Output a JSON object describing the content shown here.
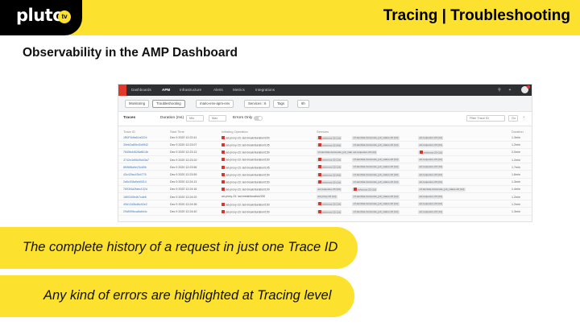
{
  "header": {
    "logo_text": "pluto",
    "logo_badge": "tv",
    "title": "Tracing | Troubleshooting",
    "accent_color": "#fde12f"
  },
  "subtitle": "Observability in the AMP Dashboard",
  "dashboard": {
    "nav": [
      "Dashboards",
      "APM",
      "Infrastructure",
      "Alerts",
      "Metrics",
      "Integrations"
    ],
    "active_nav": "APM",
    "filters": {
      "tabs": [
        "Monitoring",
        "Troubleshooting"
      ],
      "active_tab": "Troubleshooting",
      "service": "mario-env-apm-env",
      "services": "Services : 6",
      "tags": "Tags",
      "range": "6h"
    },
    "bar": {
      "title": "Traces",
      "duration_label": "Duration (ms)",
      "min_placeholder": "Min",
      "max_placeholder": "Max",
      "errors_label": "Errors Only",
      "trace_filter_placeholder": "Filter Trace ID",
      "go_label": "Go"
    },
    "columns": [
      "Trace ID",
      "Start Time",
      "Initiating Operation",
      "Services",
      "Duration"
    ],
    "rows": [
      {
        "trace_id": "1B0F6dfa61a0224",
        "time": "Dec 9 2020 12:22:41",
        "op": "ad-proxy-23: /ad-break/duration/200",
        "op_err": true,
        "services": [
          "ad-proxy-23 (1d)",
          "vrf-lambda-transcode_job_status-23 (1d)",
          "ad-requester-23 (1d)"
        ],
        "svc_err": [
          0
        ],
        "duration": "1.3min"
      },
      {
        "trace_id": "39eb2a89e40d9f42",
        "time": "Dec 9 2020 12:23:07",
        "op": "ad-proxy-23: /ad-break/duration/105",
        "op_err": true,
        "services": [
          "ad-proxy-23 (4d)",
          "vrf-lambda-transcode_job_status-23 (1d)",
          "ad-requester-23 (2d)"
        ],
        "svc_err": [
          0
        ],
        "duration": "1.2min"
      },
      {
        "trace_id": "7845bd4628af814b",
        "time": "Dec 9 2020 12:23:13",
        "op": "ad-proxy-23: /ad-break/duration/150",
        "op_err": true,
        "services": [
          "vrf-lambda-transcode_job_status-23 (1d)",
          "ad-requester-23 (1d)",
          "ad-proxy-23 (1d)"
        ],
        "svc_err": [
          2
        ],
        "duration": "2.0min"
      },
      {
        "trace_id": "3742e3d9649d43a7",
        "time": "Dec 9 2020 12:23:20",
        "op": "ad-proxy-23: /ad-break/duration/150",
        "op_err": true,
        "services": [
          "ad-proxy-23 (1d)",
          "vrf-lambda-transcode_job_status-23 (1d)",
          "ad-requester-23 (2d)"
        ],
        "svc_err": [
          0
        ],
        "duration": "1.2min"
      },
      {
        "trace_id": "8f0f6f8a9e23c69b",
        "time": "Dec 9 2020 12:23:56",
        "op": "ad-proxy-23: /ad-break/duration/105",
        "op_err": true,
        "services": [
          "ad-proxy-23 (1d)",
          "vrf-lambda-transcode_job_status-23 (1d)",
          "ad-requester-23 (1d)"
        ],
        "svc_err": [
          0
        ],
        "duration": "1.7min"
      },
      {
        "trace_id": "43c42fac43b4776",
        "time": "Dec 9 2020 12:23:59",
        "op": "ad-proxy-23: /ad-break/duration/150",
        "op_err": true,
        "services": [
          "ad-proxy-23 (4d)",
          "vrf-lambda-transcode_job_status-23 (2d)",
          "ad-requester-23 (2d)"
        ],
        "svc_err": [
          0
        ],
        "duration": "1.6min"
      },
      {
        "trace_id": "2a5c93fa9eb0014",
        "time": "Dec 9 2020 12:24:13",
        "op": "ad-proxy-23: /ad-break/duration/150",
        "op_err": true,
        "services": [
          "ad-proxy-23 (1d)",
          "vrf-lambda-transcode_job_status-23 (1d)",
          "ad-requester-23 (2d)"
        ],
        "svc_err": [
          0
        ],
        "duration": "1.3min"
      },
      {
        "trace_id": "7693f4a2fabc102d",
        "time": "Dec 9 2020 12:24:16",
        "op": "ad-proxy-23: /ad-break/duration/100",
        "op_err": true,
        "services": [
          "ad-requester-23 (2d)",
          "ad-proxy-23 (1d)",
          "vrf-lambda-transcode_job_status-23 (1d)"
        ],
        "svc_err": [
          1
        ],
        "duration": "1.4min"
      },
      {
        "trace_id": "18f0340b4b7cde6",
        "time": "Dec 9 2020 12:24:20",
        "op": "ad-proxy-23: /ad-break/duration/150",
        "op_err": false,
        "services": [
          "ad-proxy-23 (1d)",
          "vrf-lambda-transcode_job_status-23 (1d)",
          "ad-requester-23 (2d)"
        ],
        "svc_err": [],
        "duration": "1.2min"
      },
      {
        "trace_id": "40b1345bd6c92e2",
        "time": "Dec 9 2020 12:24:36",
        "op": "ad-proxy-23: /ad-break/duration/150",
        "op_err": true,
        "services": [
          "ad-proxy-23 (1d)",
          "vrf-lambda-transcode_job_status-23 (1d)",
          "ad-requester-23 (2d)"
        ],
        "svc_err": [
          0
        ],
        "duration": "1.2min"
      },
      {
        "trace_id": "29df0f9bca8abb4c",
        "time": "Dec 9 2020 12:24:40",
        "op": "ad-proxy-23: /ad-break/duration/150",
        "op_err": true,
        "services": [
          "ad-proxy-23 (1d)",
          "vrf-lambda-transcode_job_status-23 (1d)",
          "ad-requester-23 (1d)"
        ],
        "svc_err": [
          0
        ],
        "duration": "1.3min"
      }
    ]
  },
  "callouts": [
    "The complete history of a request in just one Trace ID",
    "Any kind of errors are highlighted at Tracing level"
  ]
}
